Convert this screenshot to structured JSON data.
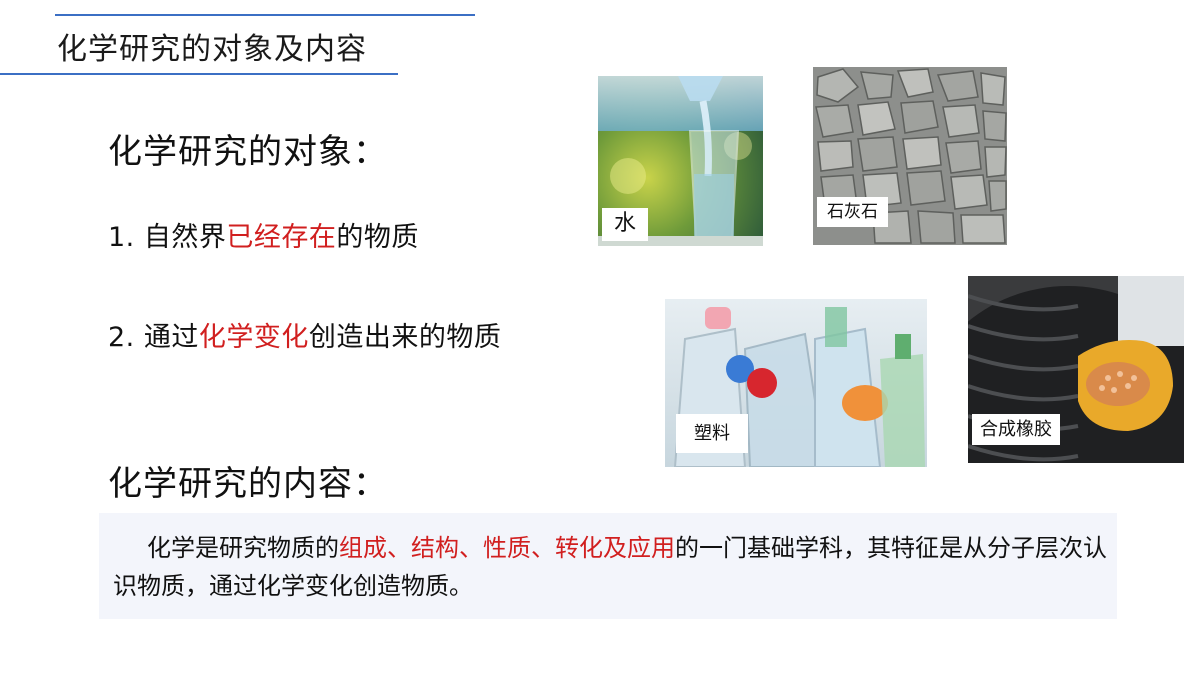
{
  "header": {
    "title": "化学研究的对象及内容"
  },
  "objects": {
    "title": "化学研究的对象：",
    "items": [
      {
        "prefix": "1. 自然界",
        "highlight": "已经存在",
        "suffix": "的物质"
      },
      {
        "prefix": "2. 通过",
        "highlight": "化学变化",
        "suffix": "创造出来的物质"
      }
    ]
  },
  "photos": [
    {
      "label": "水",
      "icon": "water-glass"
    },
    {
      "label": "石灰石",
      "icon": "limestone"
    },
    {
      "label": "塑料",
      "icon": "plastic-bottles"
    },
    {
      "label": "合成橡胶",
      "icon": "tire-rubber"
    }
  ],
  "content": {
    "title": "化学研究的内容：",
    "desc_prefix": "化学是研究物质的",
    "desc_highlight": "组成、结构、性质、转化及应用",
    "desc_suffix": "的一门基础学科，其特征是从分子层次认识物质，通过化学变化创造物质。"
  },
  "colors": {
    "accent": "#3b6fc4",
    "highlight": "#d11f1f",
    "box_bg": "#f3f5fb"
  }
}
